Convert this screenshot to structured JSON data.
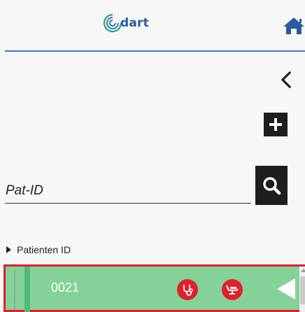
{
  "header": {
    "logo_text": "dart",
    "home_icon": "home-icon"
  },
  "toolbar": {
    "back_icon": "chevron-left-icon",
    "add_icon": "plus-icon"
  },
  "search": {
    "placeholder": "Pat-ID",
    "value": "",
    "button_icon": "search-icon"
  },
  "group": {
    "label": "Patienten ID",
    "expanded": false
  },
  "patients": [
    {
      "id": "0021",
      "status_icons": [
        "stethoscope-icon",
        "dental-chair-icon"
      ],
      "row_color": "#84d19a",
      "selected": true
    }
  ],
  "colors": {
    "brand": "#2b5a9e",
    "accent_line": "#3f74bf",
    "row_highlight": "#e2202a",
    "status_red": "#e0202b"
  }
}
